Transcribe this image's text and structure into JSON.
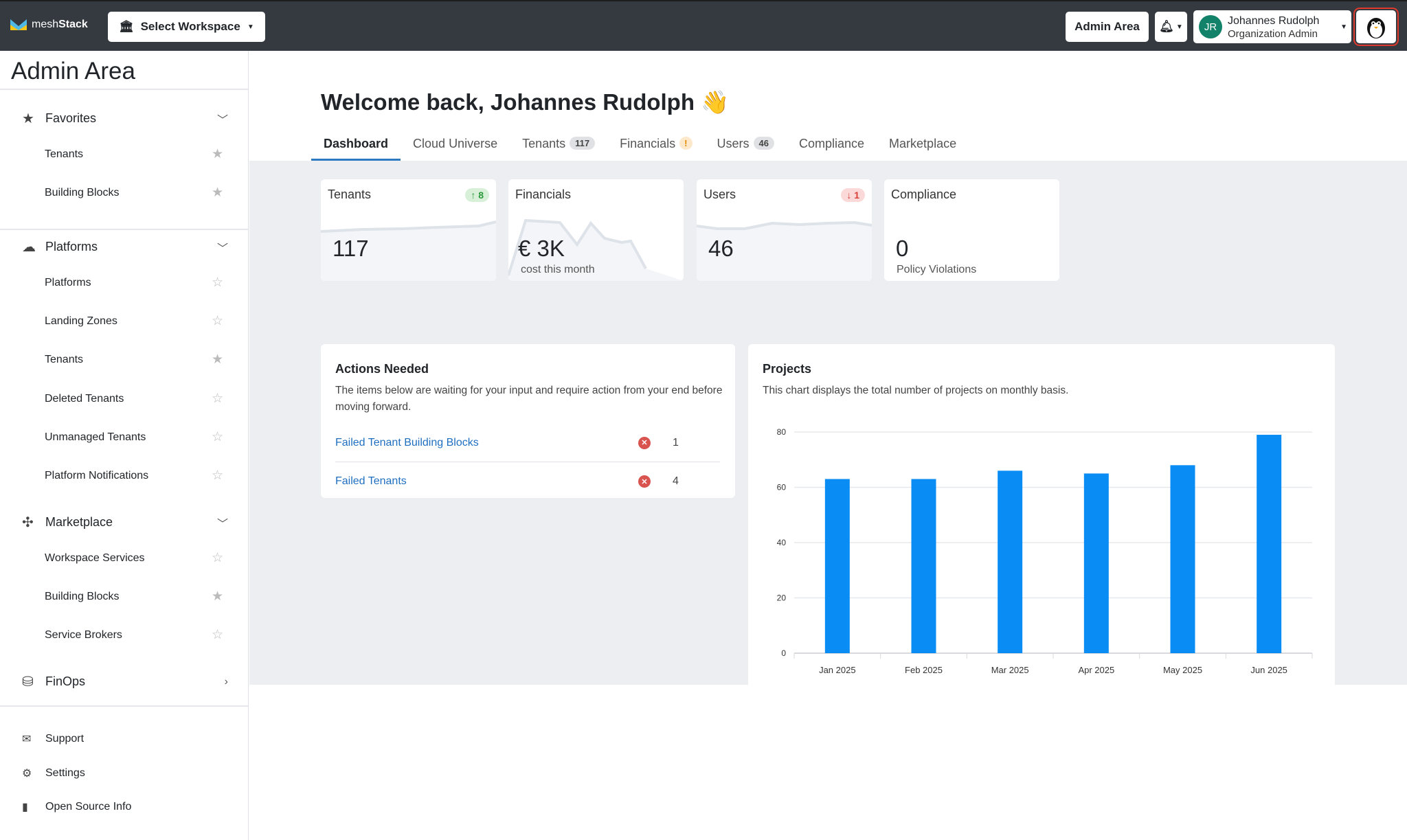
{
  "topbar": {
    "logo": {
      "a": "mesh",
      "b": "Stack"
    },
    "workspace_label": "Select Workspace",
    "admin_label": "Admin Area",
    "user": {
      "initials": "JR",
      "name": "Johannes Rudolph",
      "role": "Organization Admin"
    }
  },
  "sidebar": {
    "title": "Admin Area",
    "sections": [
      {
        "label": "Favorites",
        "items": [
          {
            "label": "Tenants",
            "starred": true
          },
          {
            "label": "Building Blocks",
            "starred": true
          }
        ]
      },
      {
        "label": "Platforms",
        "items": [
          {
            "label": "Platforms",
            "starred": false
          },
          {
            "label": "Landing Zones",
            "starred": false
          },
          {
            "label": "Tenants",
            "starred": true
          },
          {
            "label": "Deleted Tenants",
            "starred": false
          },
          {
            "label": "Unmanaged Tenants",
            "starred": false
          },
          {
            "label": "Platform Notifications",
            "starred": false
          }
        ]
      },
      {
        "label": "Marketplace",
        "items": [
          {
            "label": "Workspace Services",
            "starred": false
          },
          {
            "label": "Building Blocks",
            "starred": true
          },
          {
            "label": "Service Brokers",
            "starred": false
          }
        ]
      },
      {
        "label": "FinOps",
        "items": []
      }
    ],
    "footer": [
      {
        "label": "Support"
      },
      {
        "label": "Settings"
      },
      {
        "label": "Open Source Info"
      }
    ]
  },
  "main": {
    "welcome": "Welcome back, Johannes Rudolph 👋",
    "tabs": [
      {
        "label": "Dashboard"
      },
      {
        "label": "Cloud Universe"
      },
      {
        "label": "Tenants",
        "badge": "117"
      },
      {
        "label": "Financials",
        "badge": "!"
      },
      {
        "label": "Users",
        "badge": "46"
      },
      {
        "label": "Compliance"
      },
      {
        "label": "Marketplace"
      }
    ],
    "kpis": [
      {
        "label": "Tenants",
        "value": "117",
        "badge": "↑ 8"
      },
      {
        "label": "Financials",
        "value": "€ 3K",
        "sub": "cost this month"
      },
      {
        "label": "Users",
        "value": "46",
        "badge": "↓ 1"
      },
      {
        "label": "Compliance",
        "value": "0",
        "sub": "Policy Violations"
      }
    ],
    "actions": {
      "title": "Actions Needed",
      "desc": "The items below are waiting for your input and require action from your end before moving forward.",
      "rows": [
        {
          "label": "Failed Tenant Building Blocks",
          "count": "1"
        },
        {
          "label": "Failed Tenants",
          "count": "4"
        }
      ]
    },
    "projects": {
      "title": "Projects",
      "desc": "This chart displays the total number of projects on monthly basis."
    }
  },
  "chart_data": {
    "type": "bar",
    "title": "Projects",
    "categories": [
      "Jan 2025",
      "Feb 2025",
      "Mar 2025",
      "Apr 2025",
      "May 2025",
      "Jun 2025"
    ],
    "values": [
      63,
      63,
      66,
      65,
      68,
      79
    ],
    "yticks": [
      0,
      20,
      40,
      60,
      80
    ],
    "ylim": [
      0,
      80
    ],
    "color": "#0a8cf5",
    "grid": true
  }
}
